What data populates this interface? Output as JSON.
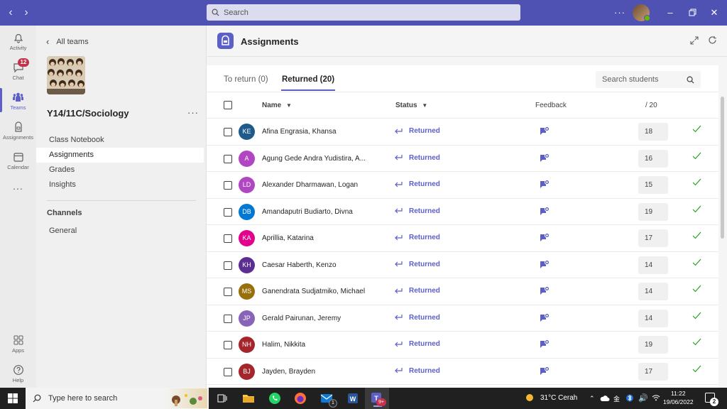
{
  "titlebar": {
    "search_placeholder": "Search",
    "colors": {
      "bar": "#4f52b2"
    }
  },
  "rail": {
    "items": [
      {
        "label": "Activity",
        "icon": "bell-icon"
      },
      {
        "label": "Chat",
        "icon": "chat-icon",
        "badge": "12"
      },
      {
        "label": "Teams",
        "icon": "teams-icon",
        "active": true
      },
      {
        "label": "Assignments",
        "icon": "assignments-icon"
      },
      {
        "label": "Calendar",
        "icon": "calendar-icon"
      },
      {
        "label": "...",
        "icon": "more-icon"
      },
      {
        "label": "Apps",
        "icon": "apps-icon"
      },
      {
        "label": "Help",
        "icon": "help-icon"
      }
    ]
  },
  "team_panel": {
    "back_label": "All teams",
    "team_name": "Y14/11C/Sociology",
    "more": "···",
    "nav": [
      "Class Notebook",
      "Assignments",
      "Grades",
      "Insights"
    ],
    "selected": "Assignments",
    "channels_heading": "Channels",
    "channels": [
      "General"
    ]
  },
  "header": {
    "title": "Assignments"
  },
  "tabs": {
    "to_return": "To return (0)",
    "returned": "Returned (20)"
  },
  "search_students": {
    "placeholder": "Search students"
  },
  "table": {
    "columns": {
      "name": "Name",
      "status": "Status",
      "feedback": "Feedback",
      "points": "/ 20"
    },
    "rows": [
      {
        "initials": "KE",
        "name": "Afina Engrasia, Khansa",
        "status": "Returned",
        "grade": "18",
        "color": "#1e5b8c"
      },
      {
        "initials": "A",
        "name": "Agung Gede Andra Yudistira, A...",
        "status": "Returned",
        "grade": "16",
        "color": "#b146c2"
      },
      {
        "initials": "LD",
        "name": "Alexander Dharmawan, Logan",
        "status": "Returned",
        "grade": "15",
        "color": "#b146c2"
      },
      {
        "initials": "DB",
        "name": "Amandaputri Budiarto, Divna",
        "status": "Returned",
        "grade": "19",
        "color": "#0078d4"
      },
      {
        "initials": "KA",
        "name": "Aprillia, Katarina",
        "status": "Returned",
        "grade": "17",
        "color": "#e3008c"
      },
      {
        "initials": "KH",
        "name": "Caesar Haberth, Kenzo",
        "status": "Returned",
        "grade": "14",
        "color": "#5c2e91"
      },
      {
        "initials": "MS",
        "name": "Ganendrata Sudjatmiko, Michael",
        "status": "Returned",
        "grade": "14",
        "color": "#986f0b"
      },
      {
        "initials": "JP",
        "name": "Gerald Pairunan, Jeremy",
        "status": "Returned",
        "grade": "14",
        "color": "#8764b8"
      },
      {
        "initials": "NH",
        "name": "Halim, Nikkita",
        "status": "Returned",
        "grade": "19",
        "color": "#a4262c"
      },
      {
        "initials": "BJ",
        "name": "Jayden, Brayden",
        "status": "Returned",
        "grade": "17",
        "color": "#a4262c"
      }
    ]
  },
  "taskbar": {
    "search_placeholder": "Type here to search",
    "weather": "31°C  Cerah",
    "time": "11:22",
    "date": "19/06/2022",
    "notification_count": "2",
    "outlook_badge": "1",
    "teams_badge": "9+"
  },
  "accent": "#5b5fc7"
}
